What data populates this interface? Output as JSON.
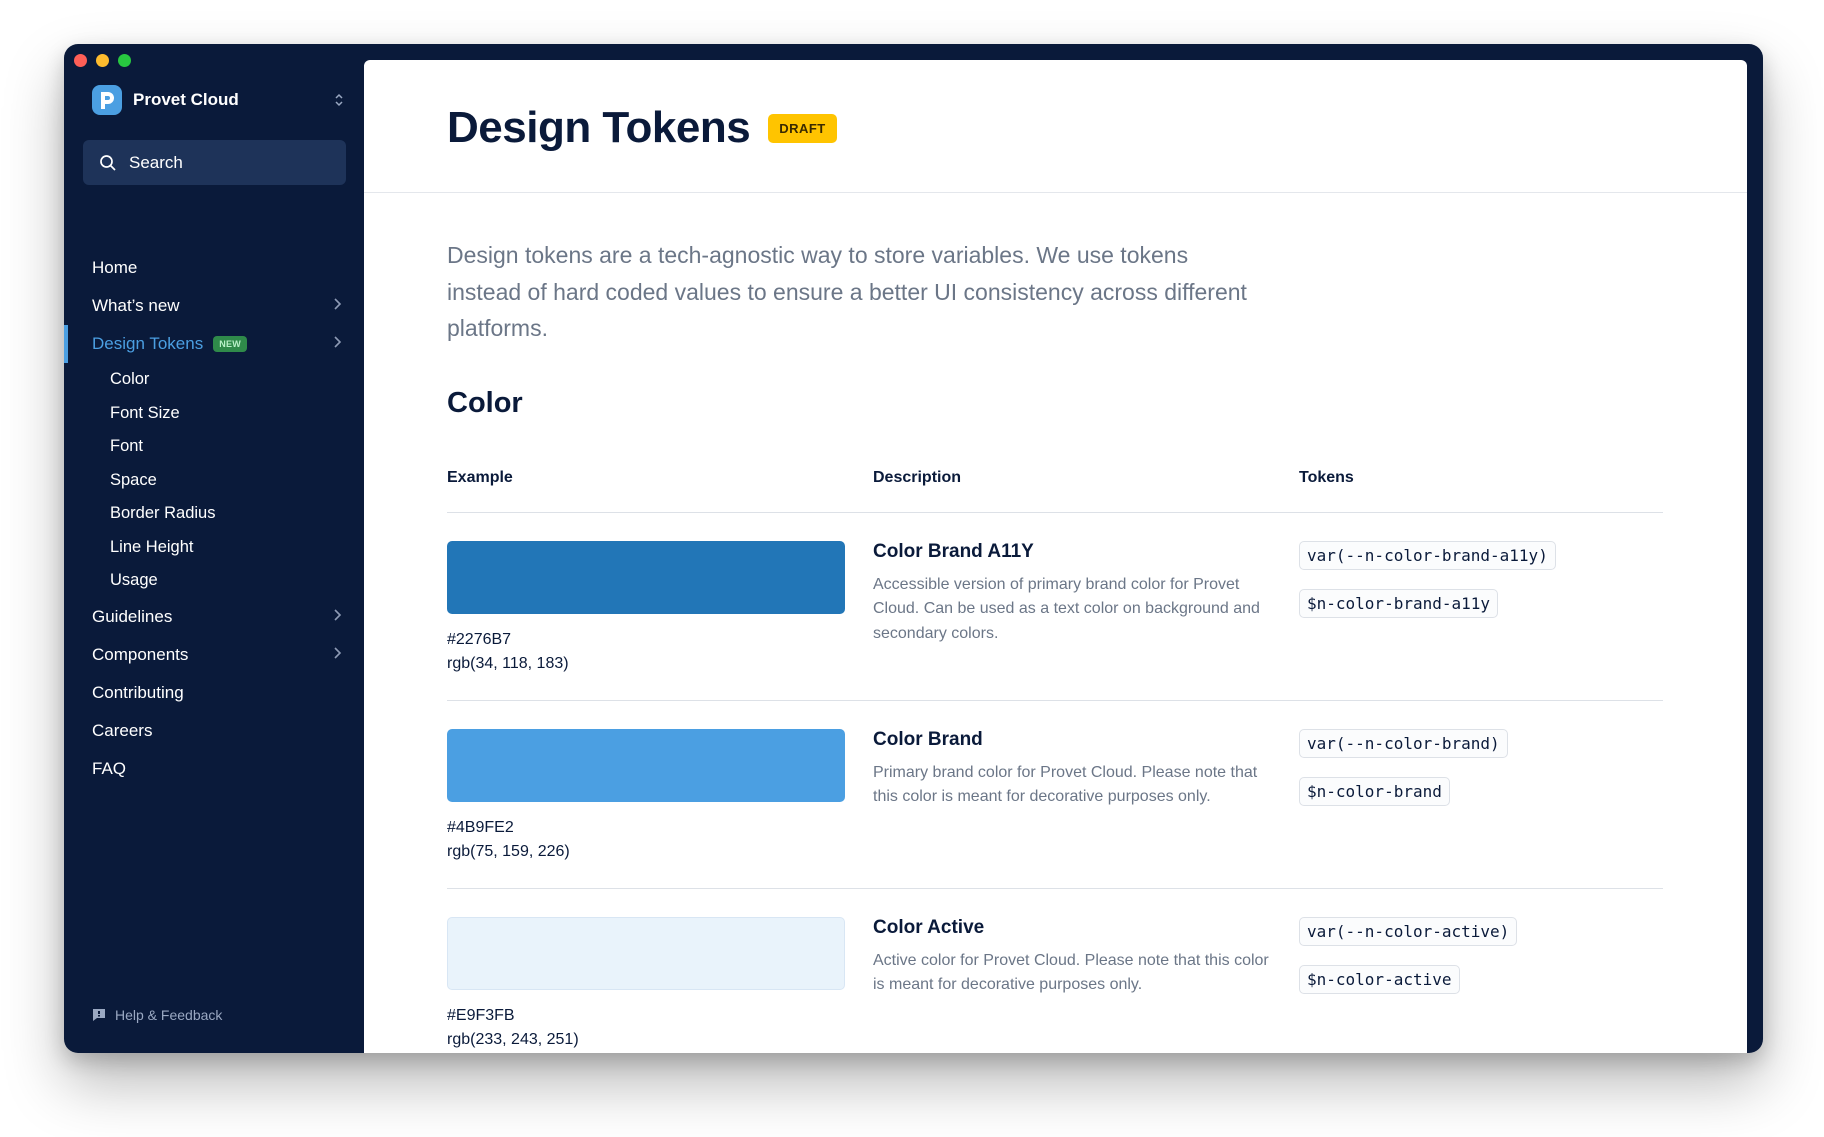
{
  "app": {
    "name": "Provet Cloud"
  },
  "sidebar": {
    "search_placeholder": "Search",
    "items": [
      {
        "label": "Home",
        "chevron": false
      },
      {
        "label": "What’s new",
        "chevron": true
      }
    ],
    "active_item": {
      "label": "Design Tokens",
      "badge": "NEW"
    },
    "sub_items": [
      "Color",
      "Font Size",
      "Font",
      "Space",
      "Border Radius",
      "Line Height",
      "Usage"
    ],
    "bottom_items": [
      {
        "label": "Guidelines",
        "chevron": true
      },
      {
        "label": "Components",
        "chevron": true
      },
      {
        "label": "Contributing",
        "chevron": false
      },
      {
        "label": "Careers",
        "chevron": false
      },
      {
        "label": "FAQ",
        "chevron": false
      }
    ],
    "help_label": "Help & Feedback"
  },
  "main": {
    "title": "Design Tokens",
    "title_badge": "DRAFT",
    "intro": "Design tokens are a tech-agnostic way to store variables. We use tokens instead of hard coded values to ensure a better UI consistency across different platforms.",
    "section_title": "Color",
    "table": {
      "headers": [
        "Example",
        "Description",
        "Tokens"
      ],
      "rows": [
        {
          "color": "#2276B7",
          "hex": "#2276B7",
          "rgb": "rgb(34, 118, 183)",
          "title": "Color Brand A11Y",
          "description": "Accessible version of primary brand color for Provet Cloud. Can be used as a text color on background and secondary colors.",
          "css_token": "var(--n-color-brand-a11y)",
          "scss_token": "$n-color-brand-a11y"
        },
        {
          "color": "#4B9FE2",
          "hex": "#4B9FE2",
          "rgb": "rgb(75, 159, 226)",
          "title": "Color Brand",
          "description": "Primary brand color for Provet Cloud. Please note that this color is meant for decorative purposes only.",
          "css_token": "var(--n-color-brand)",
          "scss_token": "$n-color-brand"
        },
        {
          "color": "#E9F3FB",
          "hex": "#E9F3FB",
          "rgb": "rgb(233, 243, 251)",
          "title": "Color Active",
          "description": "Active color for Provet Cloud. Please note that this color is meant for decorative purposes only.",
          "css_token": "var(--n-color-active)",
          "scss_token": "$n-color-active"
        }
      ]
    }
  },
  "colors": {
    "sidebar_bg": "#0a1a3a",
    "accent": "#4b9fe2",
    "draft_badge": "#ffc400",
    "new_badge": "#2f8a4a"
  }
}
